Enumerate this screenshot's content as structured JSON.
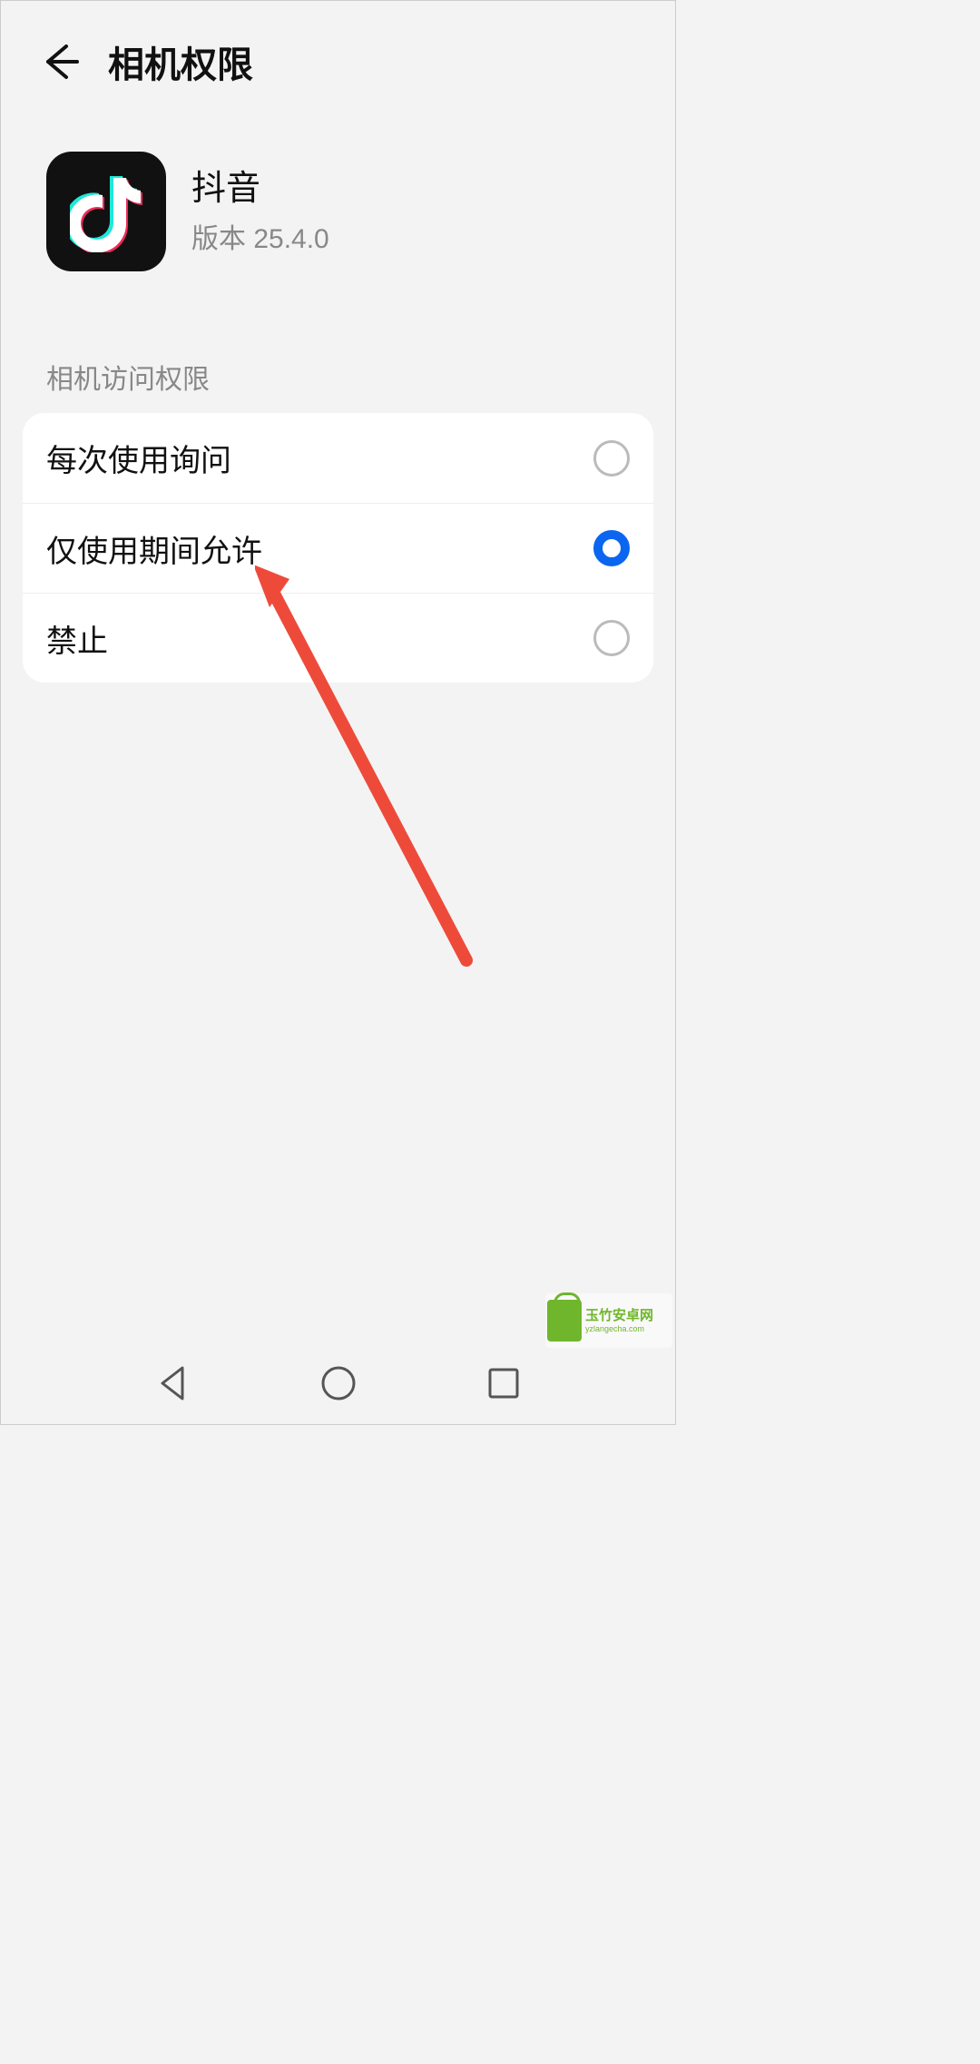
{
  "header": {
    "title": "相机权限"
  },
  "app": {
    "name": "抖音",
    "version": "版本 25.4.0"
  },
  "section": {
    "label": "相机访问权限"
  },
  "options": {
    "ask": "每次使用询问",
    "while_using": "仅使用期间允许",
    "deny": "禁止",
    "selected": "while_using"
  },
  "watermark": {
    "line1": "玉竹安卓网",
    "line2": "yzlangecha.com"
  }
}
